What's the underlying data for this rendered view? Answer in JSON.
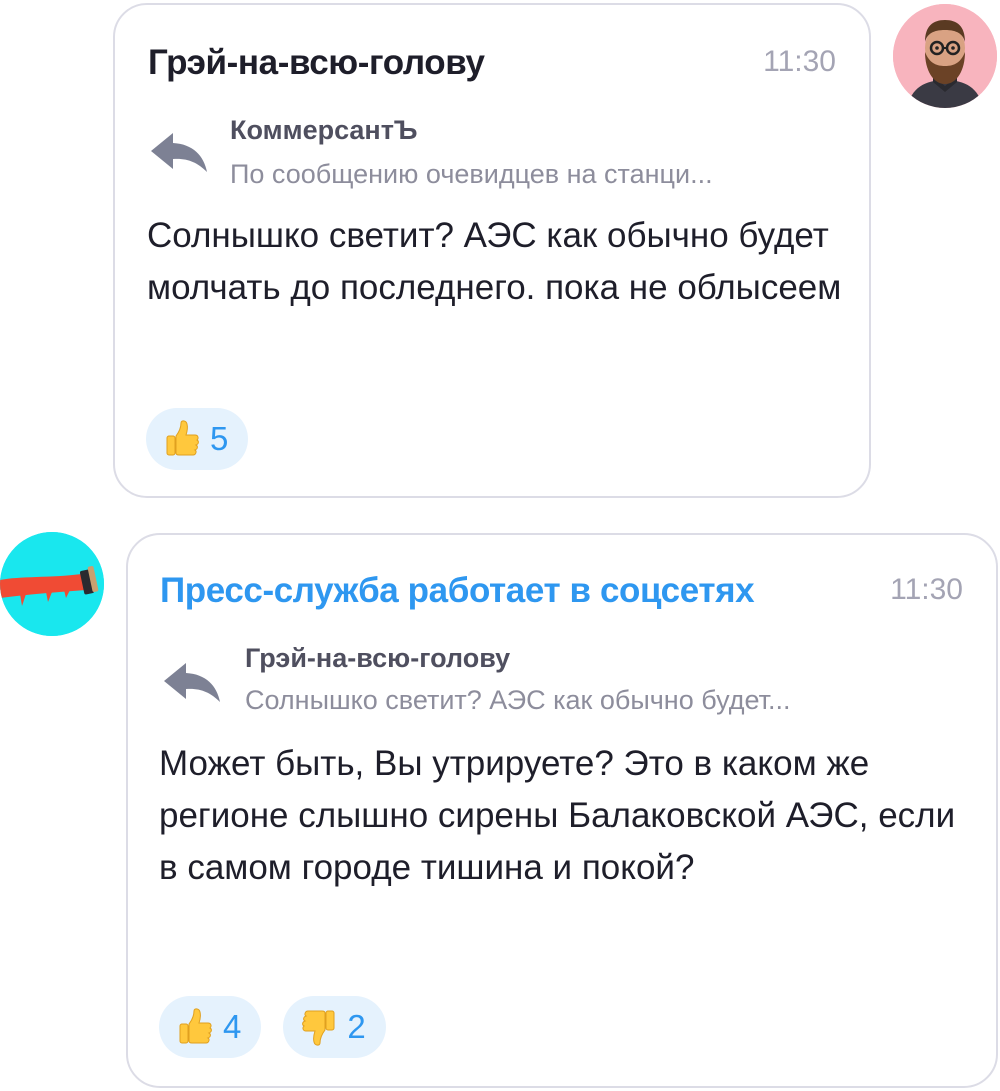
{
  "messages": [
    {
      "author": "Грэй-на-всю-голову",
      "time": "11:30",
      "reply": {
        "author": "КоммерсантЪ",
        "text": "По сообщению очевидцев на станци..."
      },
      "text": "Солнышко светит? АЭС как обычно будет молчать до последнего. пока не облысеем",
      "reactions": [
        {
          "emoji": "thumbs-up-icon",
          "count": "5"
        }
      ]
    },
    {
      "author": "Пресс-служба работает в соцсетях",
      "time": "11:30",
      "reply": {
        "author": "Грэй-на-всю-голову",
        "text": "Солнышко светит? АЭС как обычно будет..."
      },
      "text": "Может быть, Вы утрируете? Это в каком же регионе слышно сирены Балаковской АЭС, если в самом городе тишина и покой?",
      "reactions": [
        {
          "emoji": "thumbs-up-icon",
          "count": "4"
        },
        {
          "emoji": "thumbs-down-icon",
          "count": "2"
        }
      ]
    }
  ],
  "colors": {
    "accent": "#2e97f0",
    "bubble_border": "#dcdce6",
    "reaction_bg": "#e5f2fd",
    "avatar1_bg": "#f8b4be",
    "avatar2_bg": "#19e7ee"
  }
}
